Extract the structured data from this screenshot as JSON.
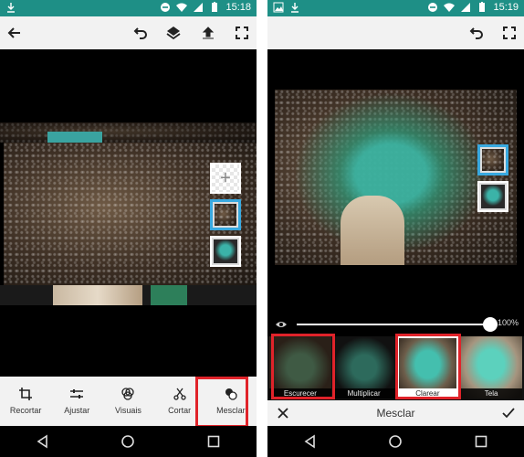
{
  "left": {
    "status": {
      "time": "15:18"
    },
    "toolbar": {
      "back_icon": "arrow-left-icon",
      "undo_icon": "undo-icon",
      "layers_icon": "layers-icon",
      "share_icon": "upload-icon",
      "fullscreen_icon": "fullscreen-icon"
    },
    "tools": [
      {
        "label": "Recortar",
        "icon": "crop-icon"
      },
      {
        "label": "Ajustar",
        "icon": "sliders-icon"
      },
      {
        "label": "Visuais",
        "icon": "looks-icon"
      },
      {
        "label": "Cortar",
        "icon": "scissors-icon"
      },
      {
        "label": "Mesclar",
        "icon": "blend-icon"
      }
    ]
  },
  "right": {
    "status": {
      "time": "15:19"
    },
    "opacity": {
      "value_label": "100%",
      "value": 1.0
    },
    "blend_modes": [
      {
        "label": "Escurecer"
      },
      {
        "label": "Multiplicar"
      },
      {
        "label": "Clarear"
      },
      {
        "label": "Tela"
      }
    ],
    "bottom": {
      "title": "Mesclar"
    }
  },
  "colors": {
    "status_bar": "#1e8f86",
    "highlight": "#e0232a",
    "selected_layer": "#39a9e0",
    "toolbar_bg": "#f2f2f2"
  }
}
